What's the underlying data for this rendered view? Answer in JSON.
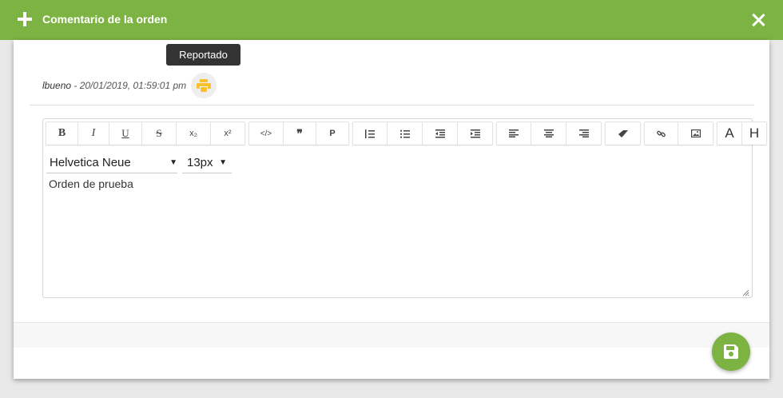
{
  "dialog": {
    "title": "Comentario de la orden",
    "tooltip": "Reportado",
    "author": "lbueno",
    "timestamp": " - 20/01/2019, 01:59:01 pm"
  },
  "toolbar": {
    "bold": "B",
    "italic": "I",
    "underline": "U",
    "strike": "S",
    "subscript": "x₂",
    "superscript": "x²",
    "code": "</>",
    "quote": "❞",
    "paragraph": "P",
    "font_color": "A",
    "heading": "H"
  },
  "editor": {
    "font_family": "Helvetica Neue",
    "font_size": "13px",
    "content": "Orden de prueba"
  },
  "colors": {
    "brand_green": "#7cb342",
    "printer_yellow": "#fbc02d"
  },
  "icons": [
    "plus-icon",
    "close-icon",
    "printer-icon",
    "ordered-list-icon",
    "unordered-list-icon",
    "outdent-icon",
    "indent-icon",
    "align-left-icon",
    "align-center-icon",
    "align-right-icon",
    "eraser-icon",
    "link-icon",
    "image-icon",
    "save-icon"
  ]
}
